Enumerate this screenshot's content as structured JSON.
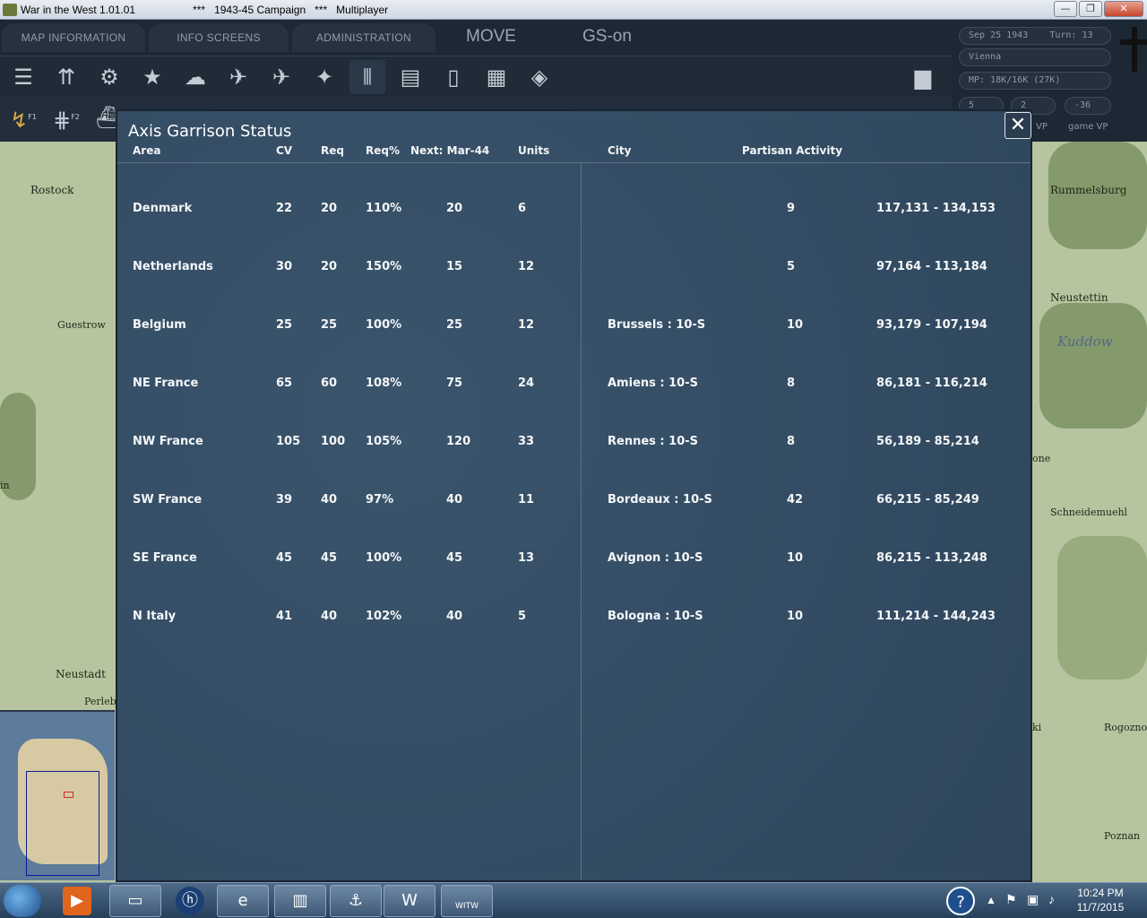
{
  "window": {
    "title": "War in the West 1.01.01",
    "subtitle": "***   1943-45 Campaign   ***   Multiplayer",
    "buttons": {
      "minimize": "—",
      "maximize": "❐",
      "close": "✕"
    }
  },
  "menu": {
    "tabs": [
      "MAP INFORMATION",
      "INFO SCREENS",
      "ADMINISTRATION"
    ],
    "mode": "MOVE",
    "gs": "GS-on"
  },
  "toolbar": {
    "icons": [
      "unit-list-icon",
      "reinforce-icon",
      "gear-icon",
      "star-icon",
      "weather-icon",
      "air-icon",
      "plane-icon",
      "bomb-icon",
      "units-icon",
      "production-icon",
      "card-icon",
      "chart-icon",
      "paradrop-icon"
    ],
    "secondary": {
      "f1": "F1",
      "f2": "F2"
    }
  },
  "info": {
    "date": "Sep 25 1943",
    "turn": "Turn: 13",
    "hq": "Vienna",
    "mp": "MP: 18K/16K (27K)",
    "vp1": "5",
    "vp2": "2",
    "vp3": "-36",
    "vp_label": "VP",
    "game_vp_label": "game VP"
  },
  "map": {
    "labels": [
      "Rostock",
      "Guestrow",
      "Neustadt",
      "Perleb",
      "Rummelsburg",
      "Neustettin",
      "Kuddow",
      "Schneidemuehl",
      "Rogozno",
      "Poznan",
      "one",
      "in",
      "ki"
    ]
  },
  "dialog": {
    "title": "Axis Garrison Status",
    "close": "✕",
    "headers": {
      "area": "Area",
      "cv": "CV",
      "req": "Req",
      "reqpct": "Req%",
      "next": "Next: Mar-44",
      "units": "Units",
      "city": "City",
      "partisan": "Partisan Activity"
    },
    "rows": [
      {
        "area": "Denmark",
        "cv": "22",
        "req": "20",
        "reqpct": "110%",
        "next": "20",
        "units": "6",
        "city": "",
        "partisan": "9",
        "range": "117,131 - 134,153"
      },
      {
        "area": "Netherlands",
        "cv": "30",
        "req": "20",
        "reqpct": "150%",
        "next": "15",
        "units": "12",
        "city": "",
        "partisan": "5",
        "range": "97,164 - 113,184"
      },
      {
        "area": "Belgium",
        "cv": "25",
        "req": "25",
        "reqpct": "100%",
        "next": "25",
        "units": "12",
        "city": "Brussels : 10-S",
        "partisan": "10",
        "range": "93,179 - 107,194"
      },
      {
        "area": "NE France",
        "cv": "65",
        "req": "60",
        "reqpct": "108%",
        "next": "75",
        "units": "24",
        "city": "Amiens : 10-S",
        "partisan": "8",
        "range": "86,181 - 116,214"
      },
      {
        "area": "NW France",
        "cv": "105",
        "req": "100",
        "reqpct": "105%",
        "next": "120",
        "units": "33",
        "city": "Rennes : 10-S",
        "partisan": "8",
        "range": "56,189 - 85,214"
      },
      {
        "area": "SW France",
        "cv": "39",
        "req": "40",
        "reqpct": "97%",
        "next": "40",
        "units": "11",
        "city": "Bordeaux : 10-S",
        "partisan": "42",
        "range": "66,215 - 85,249"
      },
      {
        "area": "SE France",
        "cv": "45",
        "req": "45",
        "reqpct": "100%",
        "next": "45",
        "units": "13",
        "city": "Avignon : 10-S",
        "partisan": "10",
        "range": "86,215 - 113,248"
      },
      {
        "area": "N Italy",
        "cv": "41",
        "req": "40",
        "reqpct": "102%",
        "next": "40",
        "units": "5",
        "city": "Bologna : 10-S",
        "partisan": "10",
        "range": "111,214 - 144,243"
      }
    ]
  },
  "taskbar": {
    "time": "10:24 PM",
    "date": "11/7/2015",
    "app_label": "WITW"
  }
}
